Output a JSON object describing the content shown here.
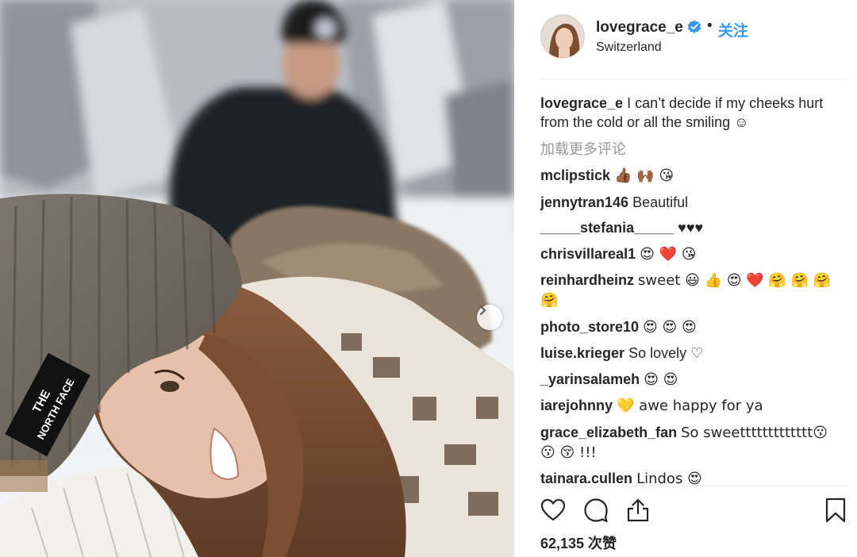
{
  "post": {
    "username": "lovegrace_e",
    "location": "Switzerland",
    "follow_label": "关注",
    "separator": "•"
  },
  "caption": {
    "username": "lovegrace_e",
    "text": "I can’t decide if my cheeks hurt from the cold or all the smiling ☺"
  },
  "load_more": "加载更多评论",
  "comments": [
    {
      "user": "mclipstick",
      "text": "👍🏾 🙌🏾 😘"
    },
    {
      "user": "jennytran146",
      "text": "Beautiful"
    },
    {
      "user": "_____stefania_____",
      "text": "♥♥♥"
    },
    {
      "user": "chrisvillareal1",
      "text": "😍 ❤️ 😘"
    },
    {
      "user": "reinhardheinz",
      "text": "sweet 😃 👍 😍 ❤️ 🤗 🤗 🤗 🤗"
    },
    {
      "user": "photo_store10",
      "text": "😍 😍 😍"
    },
    {
      "user": "luise.krieger",
      "text": "So lovely ♡"
    },
    {
      "user": "_yarinsalameh",
      "text": "😍 😍"
    },
    {
      "user": "iarejohnny",
      "text": "💛  awe happy for ya"
    },
    {
      "user": "grace_elizabeth_fan",
      "text": "So sweettttttttttttt😗 😗 😚 !!!"
    },
    {
      "user": "tainara.cullen",
      "text": "Lindos 😍"
    }
  ],
  "likes": "62,135 次赞",
  "icons": {
    "verified": "verified-badge-icon",
    "like": "heart-icon",
    "comment": "comment-bubble-icon",
    "share": "share-icon",
    "save": "bookmark-icon",
    "next": "chevron-right-icon"
  },
  "colors": {
    "link": "#3897f0",
    "muted": "#999999",
    "text": "#262626"
  }
}
